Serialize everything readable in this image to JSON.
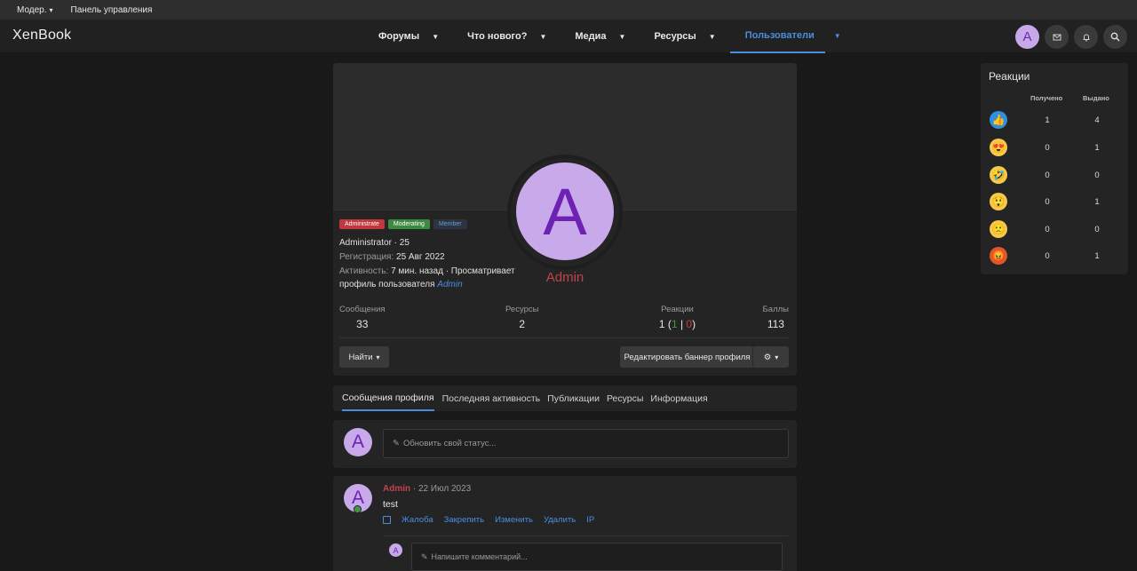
{
  "topbar": {
    "moder": "Модер.",
    "panel": "Панель управления"
  },
  "nav": {
    "logo": "XenBook",
    "tabs": [
      {
        "label": "Форумы"
      },
      {
        "label": "Что нового?"
      },
      {
        "label": "Медиа"
      },
      {
        "label": "Ресурсы"
      },
      {
        "label": "Пользователи",
        "active": true
      }
    ],
    "avatar_letter": "A"
  },
  "profile": {
    "avatar_letter": "A",
    "name": "Admin",
    "badges": [
      "Administrate",
      "Moderating",
      "Member"
    ],
    "title": "Administrator",
    "age": "25",
    "reg_label": "Регистрация:",
    "reg_date": "25 Авг 2022",
    "activity_label": "Активность:",
    "activity_text": "7 мин. назад · Просматривает профиль пользователя",
    "activity_link": "Admin",
    "stats": {
      "messages_label": "Сообщения",
      "messages": "33",
      "resources_label": "Ресурсы",
      "resources": "2",
      "reactions_label": "Реакции",
      "reactions_total": "1",
      "reactions_pos": "1",
      "reactions_neg": "0",
      "points_label": "Баллы",
      "points": "113"
    },
    "find_button": "Найти",
    "edit_banner_button": "Редактировать баннер профиля"
  },
  "profile_tabs": [
    "Сообщения профиля",
    "Последняя активность",
    "Публикации",
    "Ресурсы",
    "Информация"
  ],
  "status": {
    "placeholder": "Обновить свой статус..."
  },
  "post": {
    "author": "Admin",
    "date": "22 Июл 2023",
    "text": "test",
    "actions": [
      "Жалоба",
      "Закрепить",
      "Изменить",
      "Удалить",
      "IP"
    ],
    "comment_placeholder": "Напишите комментарий..."
  },
  "reactions": {
    "title": "Реакции",
    "received_label": "Получено",
    "given_label": "Выдано",
    "rows": [
      {
        "icon": "like",
        "emoji": "👍",
        "color": "#2f8fe0",
        "received": "1",
        "given": "4"
      },
      {
        "icon": "love",
        "emoji": "😍",
        "color": "#f6c94a",
        "received": "0",
        "given": "1"
      },
      {
        "icon": "haha",
        "emoji": "🤣",
        "color": "#f6c94a",
        "received": "0",
        "given": "0"
      },
      {
        "icon": "wow",
        "emoji": "😲",
        "color": "#f6c94a",
        "received": "0",
        "given": "1"
      },
      {
        "icon": "sad",
        "emoji": "🙁",
        "color": "#f6c94a",
        "received": "0",
        "given": "0"
      },
      {
        "icon": "angry",
        "emoji": "😡",
        "color": "#e2542e",
        "received": "0",
        "given": "1"
      }
    ]
  }
}
